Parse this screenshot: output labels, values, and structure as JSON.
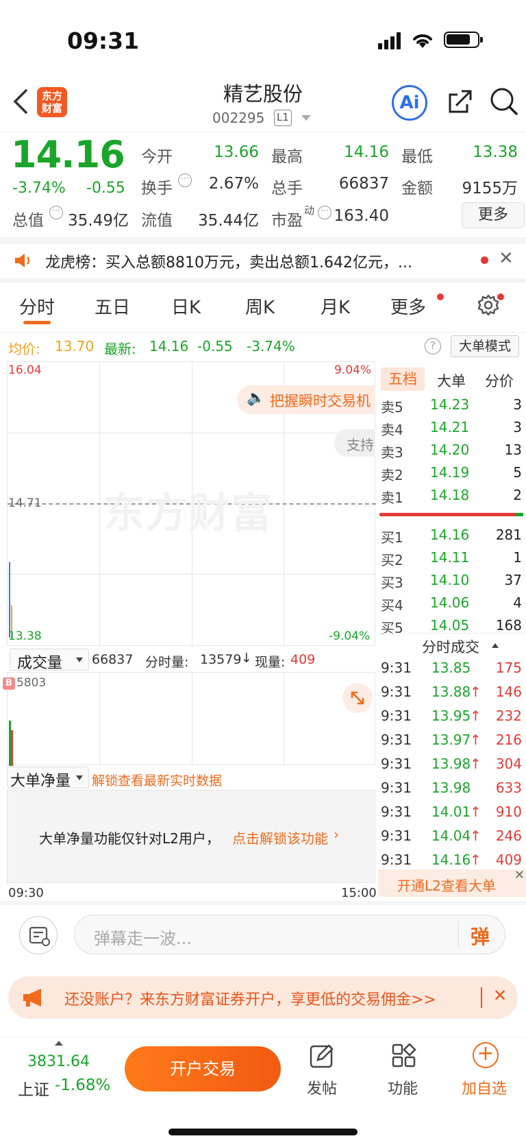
{
  "status": {
    "time": "09:31"
  },
  "header": {
    "back_label": "<",
    "logo_text": "东方财富",
    "stock_name": "精艺股份",
    "stock_code": "002295",
    "level": "L1"
  },
  "quote": {
    "last": "14.16",
    "pct": "-3.74%",
    "chg": "-0.55",
    "open_label": "今开",
    "open": "13.66",
    "high_label": "最高",
    "high": "14.16",
    "low_label": "最低",
    "low": "13.38",
    "turnover_label": "换手",
    "turnover": "2.67%",
    "volume_label": "总手",
    "volume": "66837",
    "amount_label": "金额",
    "amount": "9155万",
    "mktcap_label": "总值",
    "mktcap": "35.49亿",
    "float_label": "流值",
    "float": "35.44亿",
    "pe_label": "市盈",
    "pe_sup": "动",
    "pe": "163.40",
    "more_label": "更多"
  },
  "notice": {
    "text": "龙虎榜：买入总额8810万元，卖出总额1.642亿元，..."
  },
  "tabs": [
    "分时",
    "五日",
    "日K",
    "周K",
    "月K",
    "更多"
  ],
  "info_line": {
    "avg_label": "均价:",
    "avg": "13.70",
    "latest_label": "最新:",
    "latest": "14.16",
    "chg": "-0.55",
    "pct": "-3.74%",
    "mode_label": "大单模式"
  },
  "chart": {
    "price_max": "16.04",
    "price_min": "13.38",
    "price_mid": "14.71",
    "pct_max": "9.04%",
    "pct_min": "-9.04%",
    "promo_bubble": "把握瞬时交易机",
    "support_bubble": "支持",
    "watermark": "东方财富",
    "time_start": "09:30",
    "time_end": "15:00"
  },
  "volume_bar": {
    "selector": "成交量",
    "total": "66837",
    "minute_label": "分时量:",
    "minute": "13579",
    "now_label": "现量:",
    "now": "409",
    "max": "5803",
    "b_marker": "B"
  },
  "large_order": {
    "selector": "大单净量",
    "unlock": "解锁查看最新实时数据",
    "locked_text": "大单净量功能仅针对L2用户，",
    "locked_link": "点击解锁该功能"
  },
  "orderbook": {
    "tabs": [
      "五档",
      "大单",
      "分价"
    ],
    "asks": [
      {
        "label": "卖5",
        "price": "14.23",
        "vol": "3"
      },
      {
        "label": "卖4",
        "price": "14.21",
        "vol": "3"
      },
      {
        "label": "卖3",
        "price": "14.20",
        "vol": "13"
      },
      {
        "label": "卖2",
        "price": "14.19",
        "vol": "5"
      },
      {
        "label": "卖1",
        "price": "14.18",
        "vol": "2"
      }
    ],
    "bids": [
      {
        "label": "买1",
        "price": "14.16",
        "vol": "281"
      },
      {
        "label": "买2",
        "price": "14.11",
        "vol": "1"
      },
      {
        "label": "买3",
        "price": "14.10",
        "vol": "37"
      },
      {
        "label": "买4",
        "price": "14.06",
        "vol": "4"
      },
      {
        "label": "买5",
        "price": "14.05",
        "vol": "168"
      }
    ]
  },
  "trades": {
    "title": "分时成交",
    "rows": [
      {
        "time": "9:31",
        "price": "13.85",
        "arrow": "",
        "vol": "175"
      },
      {
        "time": "9:31",
        "price": "13.88",
        "arrow": "↑",
        "vol": "146"
      },
      {
        "time": "9:31",
        "price": "13.95",
        "arrow": "↑",
        "vol": "232"
      },
      {
        "time": "9:31",
        "price": "13.97",
        "arrow": "↑",
        "vol": "216"
      },
      {
        "time": "9:31",
        "price": "13.98",
        "arrow": "↑",
        "vol": "304"
      },
      {
        "time": "9:31",
        "price": "13.98",
        "arrow": "",
        "vol": "633"
      },
      {
        "time": "9:31",
        "price": "14.01",
        "arrow": "↑",
        "vol": "910"
      },
      {
        "time": "9:31",
        "price": "14.04",
        "arrow": "↑",
        "vol": "246"
      },
      {
        "time": "9:31",
        "price": "14.16",
        "arrow": "↑",
        "vol": "409"
      }
    ],
    "l2_promo": "开通L2查看大单"
  },
  "danmaku": {
    "placeholder": "弹幕走一波...",
    "button": "弹"
  },
  "banner": {
    "text": "还没账户？来东方财富证券开户，享更低的交易佣金>>"
  },
  "bottom": {
    "index_value": "3831.64",
    "index_name": "上证",
    "index_pct": "-1.68%",
    "trade_button": "开户交易",
    "post_label": "发帖",
    "func_label": "功能",
    "watch_label": "加自选"
  },
  "colors": {
    "up": "#e53935",
    "down": "#1aa52a",
    "brand": "#f25a23"
  }
}
